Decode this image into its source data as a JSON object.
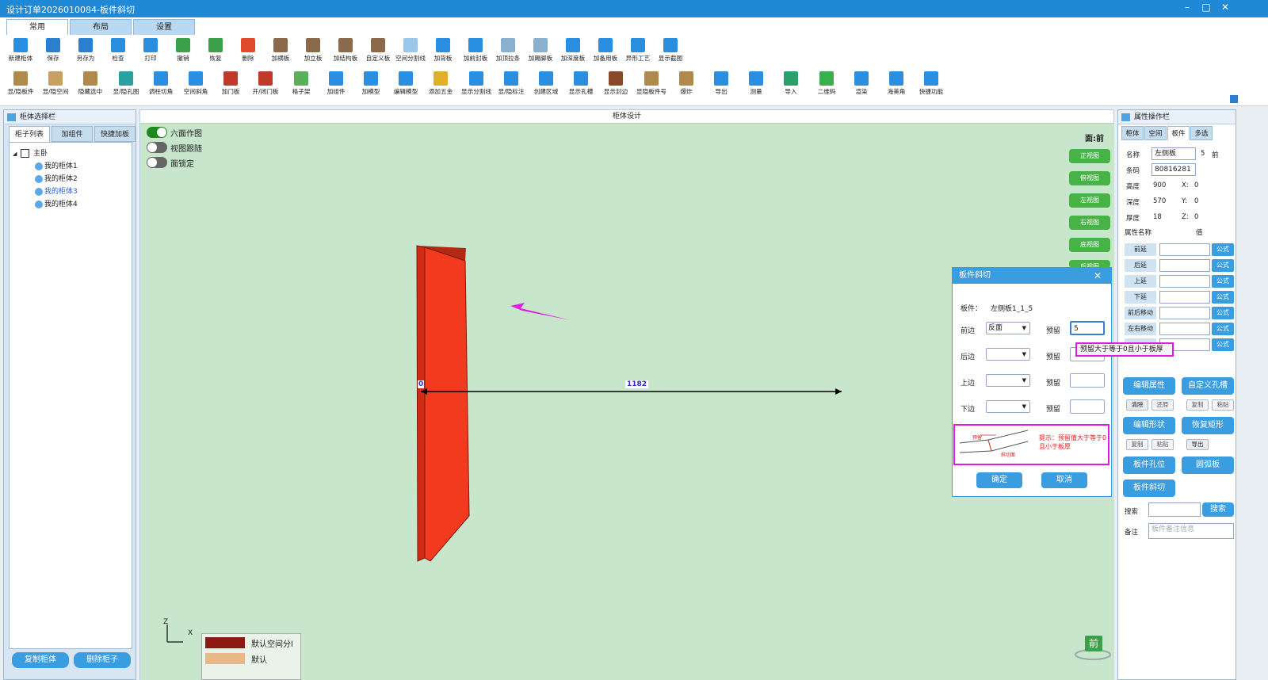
{
  "window": {
    "title": "设计订单2026010084-板件斜切",
    "min": "–",
    "max": "□",
    "close": "✕"
  },
  "main_tabs": [
    "常用",
    "布局",
    "设置"
  ],
  "toolbar_row1": [
    {
      "label": "新建柜体",
      "color": "#2a8fe0"
    },
    {
      "label": "保存",
      "color": "#2a7fd0"
    },
    {
      "label": "另存为",
      "color": "#2a7fd0"
    },
    {
      "label": "检查",
      "color": "#2a8fe0"
    },
    {
      "label": "打印",
      "color": "#2a8fe0"
    },
    {
      "label": "撤销",
      "color": "#3aa04a"
    },
    {
      "label": "恢复",
      "color": "#3aa04a"
    },
    {
      "label": "删除",
      "color": "#e04a2a"
    },
    {
      "label": "加横板",
      "color": "#8a6a4a"
    },
    {
      "label": "加立板",
      "color": "#8a6a4a"
    },
    {
      "label": "加结构板",
      "color": "#8a6a4a"
    },
    {
      "label": "自定义板",
      "color": "#8a6a4a"
    },
    {
      "label": "空间分割线",
      "color": "#9ac8ec"
    },
    {
      "label": "加背板",
      "color": "#2a8fe0"
    },
    {
      "label": "加前封板",
      "color": "#2a8fe0"
    },
    {
      "label": "加顶拉条",
      "color": "#8ab0d0"
    },
    {
      "label": "加踢脚板",
      "color": "#8ab0d0"
    },
    {
      "label": "加深度板",
      "color": "#2a8fe0"
    },
    {
      "label": "加备用板",
      "color": "#2a8fe0"
    },
    {
      "label": "异形工艺",
      "color": "#2a8fe0"
    },
    {
      "label": "显示截图",
      "color": "#2a8fe0"
    }
  ],
  "toolbar_row2": [
    {
      "label": "显/隐板件",
      "color": "#b08a4a"
    },
    {
      "label": "显/隐空间",
      "color": "#c8a060"
    },
    {
      "label": "隐藏选中",
      "color": "#b08a4a"
    },
    {
      "label": "显/隐孔图",
      "color": "#2aa0a0"
    },
    {
      "label": "调柱切角",
      "color": "#2a8fe0"
    },
    {
      "label": "空间斜角",
      "color": "#2a8fe0"
    },
    {
      "label": "加门板",
      "color": "#c03a2a"
    },
    {
      "label": "开/闭门板",
      "color": "#c03a2a"
    },
    {
      "label": "格子架",
      "color": "#5ab05a"
    },
    {
      "label": "加组件",
      "color": "#2a8fe0"
    },
    {
      "label": "加模型",
      "color": "#2a8fe0"
    },
    {
      "label": "编辑模型",
      "color": "#2a8fe0"
    },
    {
      "label": "添加五金",
      "color": "#e0b02a"
    },
    {
      "label": "显示分割线",
      "color": "#2a8fe0"
    },
    {
      "label": "显/隐标注",
      "color": "#2a8fe0"
    },
    {
      "label": "创建区域",
      "color": "#2a8fe0"
    },
    {
      "label": "显示孔槽",
      "color": "#2a8fe0"
    },
    {
      "label": "显示封边",
      "color": "#8a4a2a"
    },
    {
      "label": "显隐板件号",
      "color": "#b08a4a"
    },
    {
      "label": "爆炸",
      "color": "#b08a4a"
    },
    {
      "label": "导出",
      "color": "#2a8fe0"
    },
    {
      "label": "测量",
      "color": "#2a8fe0"
    },
    {
      "label": "导入",
      "color": "#2aa06a"
    },
    {
      "label": "二维码",
      "color": "#3ab04a"
    },
    {
      "label": "渲染",
      "color": "#2a8fe0"
    },
    {
      "label": "海美角",
      "color": "#2a8fe0"
    },
    {
      "label": "快捷功能",
      "color": "#2a8fe0"
    }
  ],
  "left_panel": {
    "title": "柜体选择栏",
    "tabs": [
      "柜子列表",
      "加组件",
      "快捷加板"
    ],
    "tree_root": "主卧",
    "tree_items": [
      "我的柜体1",
      "我的柜体2",
      "我的柜体3",
      "我的柜体4"
    ],
    "buttons": [
      "复制柜体",
      "删除柜子"
    ]
  },
  "canvas": {
    "title": "柜体设计",
    "toggles": [
      {
        "label": "六面作图",
        "on": true
      },
      {
        "label": "视图跟随",
        "on": false
      },
      {
        "label": "面锁定",
        "on": false
      }
    ],
    "face_label": "面:前",
    "view_buttons": [
      "正视图",
      "俯视图",
      "左视图",
      "右视图",
      "底视图",
      "后视图"
    ],
    "dimension_start": "0",
    "dimension_value": "1182",
    "axis_z": "Z",
    "axis_x": "X",
    "legend": [
      "默认空间分l",
      "默认"
    ],
    "face_badge": "前"
  },
  "dialog": {
    "title": "板件斜切",
    "close": "✕",
    "panel_label": "板件：",
    "panel_value": "左侧板1_1_5",
    "rows": [
      {
        "edge": "前边",
        "select": "反面",
        "reserve_label": "预留",
        "reserve_value": "5"
      },
      {
        "edge": "后边",
        "select": "",
        "reserve_label": "预留",
        "reserve_value": ""
      },
      {
        "edge": "上边",
        "select": "",
        "reserve_label": "预留",
        "reserve_value": ""
      },
      {
        "edge": "下边",
        "select": "",
        "reserve_label": "预留",
        "reserve_value": ""
      }
    ],
    "hint": "提示：预留值大于等于0且小于板厚",
    "diagram_labels": [
      "预留",
      "斜切面"
    ],
    "confirm": "确定",
    "cancel": "取消"
  },
  "tooltip": "预留大于等于0且小于板厚",
  "right_panel": {
    "title": "属性操作栏",
    "tabs": [
      "柜体",
      "空间",
      "板件",
      "多选"
    ],
    "name_label": "名称",
    "name_value": "左侧板",
    "name_count": "5",
    "name_face": "前",
    "code_label": "条码",
    "code_value": "80816281",
    "height_label": "高度",
    "height_value": "900",
    "x_label": "X:",
    "x_value": "0",
    "depth_label": "深度",
    "depth_value": "570",
    "y_label": "Y:",
    "y_value": "0",
    "thick_label": "厚度",
    "thick_value": "18",
    "z_label": "Z:",
    "z_value": "0",
    "table_header_name": "属性名称",
    "table_header_value": "值",
    "props": [
      "前延",
      "后延",
      "上延",
      "下延",
      "前后移动",
      "左右移动",
      ""
    ],
    "formula": "公式",
    "big_buttons": [
      "编辑属性",
      "自定义孔槽",
      "编辑形状",
      "恢复矩形",
      "板件孔位",
      "圆弧板",
      "板件斜切"
    ],
    "small_buttons_1": [
      "清除",
      "还原",
      "复制",
      "粘贴"
    ],
    "small_buttons_2": [
      "复制",
      "粘贴",
      "导出"
    ],
    "search_label": "搜索",
    "search_button": "搜索",
    "note_label": "备注",
    "note_placeholder": "板件备注信息"
  }
}
